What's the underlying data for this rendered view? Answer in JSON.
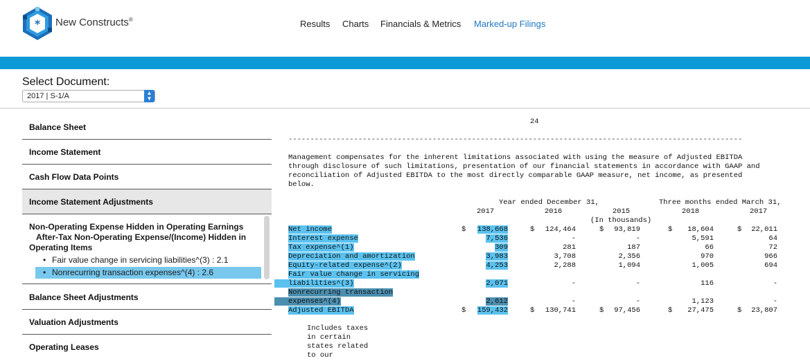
{
  "brand": {
    "name": "New Constructs",
    "mark": "®"
  },
  "nav": [
    {
      "label": "Results",
      "active": false
    },
    {
      "label": "Charts",
      "active": false
    },
    {
      "label": "Financials & Metrics",
      "active": false
    },
    {
      "label": "Marked-up Filings",
      "active": true
    }
  ],
  "colors": {
    "accent_bar": "#0e9ad6",
    "active_nav": "#1f78c1",
    "highlight": "#78c8ee"
  },
  "document_select": {
    "label": "Select Document:",
    "value": "2017 | S-1/A"
  },
  "sidebar": {
    "items": [
      {
        "label": "Balance Sheet"
      },
      {
        "label": "Income Statement"
      },
      {
        "label": "Cash Flow Data Points"
      },
      {
        "label": "Income Statement Adjustments",
        "selected": true
      }
    ],
    "expanded": {
      "title_line1": "Non-Operating Expense Hidden in Operating Earnings",
      "title_line2": "After-Tax Non-Operating Expense/(Income) Hidden in",
      "title_line3": "Operating Items",
      "bullets": [
        {
          "label": "Fair value change in servicing liabilities^(3) : 2.1",
          "highlighted": false
        },
        {
          "label": "Nonrecurring transaction expenses^(4) : 2.6",
          "highlighted": true
        }
      ]
    },
    "items_after": [
      {
        "label": "Balance Sheet Adjustments"
      },
      {
        "label": "Valuation Adjustments"
      },
      {
        "label": "Operating Leases"
      }
    ]
  },
  "doc": {
    "page_number": "24",
    "rule": "--------------------------------------------------------------------------------------------------------",
    "para": [
      "Management compensates for the inherent limitations associated with using the measure of Adjusted EBITDA",
      "through disclosure of such limitations, presentation of our financial statements in accordance with GAAP and",
      "reconciliation of Adjusted EBITDA to the most directly comparable GAAP measure, net income, as presented",
      "below."
    ],
    "hdr_year": "Year ended December 31,",
    "hdr_three": "Three months ended March 31,",
    "cols": [
      "2017",
      "2016",
      "2015",
      "2018",
      "2017"
    ],
    "unit": "(In thousands)",
    "rows": [
      {
        "label": "Net income",
        "d1": "$",
        "v1": "138,668",
        "d2": "$",
        "v2": "124,464",
        "d3": "$",
        "v3": "93,819",
        "d4": "$",
        "v4": "18,604",
        "d5": "$",
        "v5": "22,011"
      },
      {
        "label": "Interest expense",
        "v1": "7,536",
        "v2": "-",
        "v3": "-",
        "v4": "5,591",
        "v5": "64"
      },
      {
        "label": "Tax expense^(1)",
        "v1": "309",
        "v2": "281",
        "v3": "187",
        "v4": "66",
        "v5": "72"
      },
      {
        "label": "Depreciation and amortization",
        "v1": "3,983",
        "v2": "3,708",
        "v3": "2,356",
        "v4": "970",
        "v5": "966"
      },
      {
        "label": "Equity-related expense^(2)",
        "v1": "4,253",
        "v2": "2,288",
        "v3": "1,094",
        "v4": "1,005",
        "v5": "694"
      }
    ],
    "fv_label1": "Fair value change in servicing",
    "fv_label2": "liabilities^(3)",
    "fv": {
      "v1": "2,071",
      "v2": "-",
      "v3": "-",
      "v4": "116",
      "v5": "-"
    },
    "nt_label1": "Nonrecurring transaction",
    "nt_label2": "expenses^(4)",
    "nt": {
      "v1": "2,612",
      "v2": "-",
      "v3": "-",
      "v4": "1,123",
      "v5": "-"
    },
    "ae": {
      "label": "Adjusted EBITDA",
      "d1": "$",
      "v1": "159,432",
      "d2": "$",
      "v2": "130,741",
      "d3": "$",
      "v3": "97,456",
      "d4": "$",
      "v4": "27,475",
      "d5": "$",
      "v5": "23,807"
    },
    "footnote": [
      "Includes taxes",
      "in certain",
      "states related",
      "to our"
    ]
  }
}
